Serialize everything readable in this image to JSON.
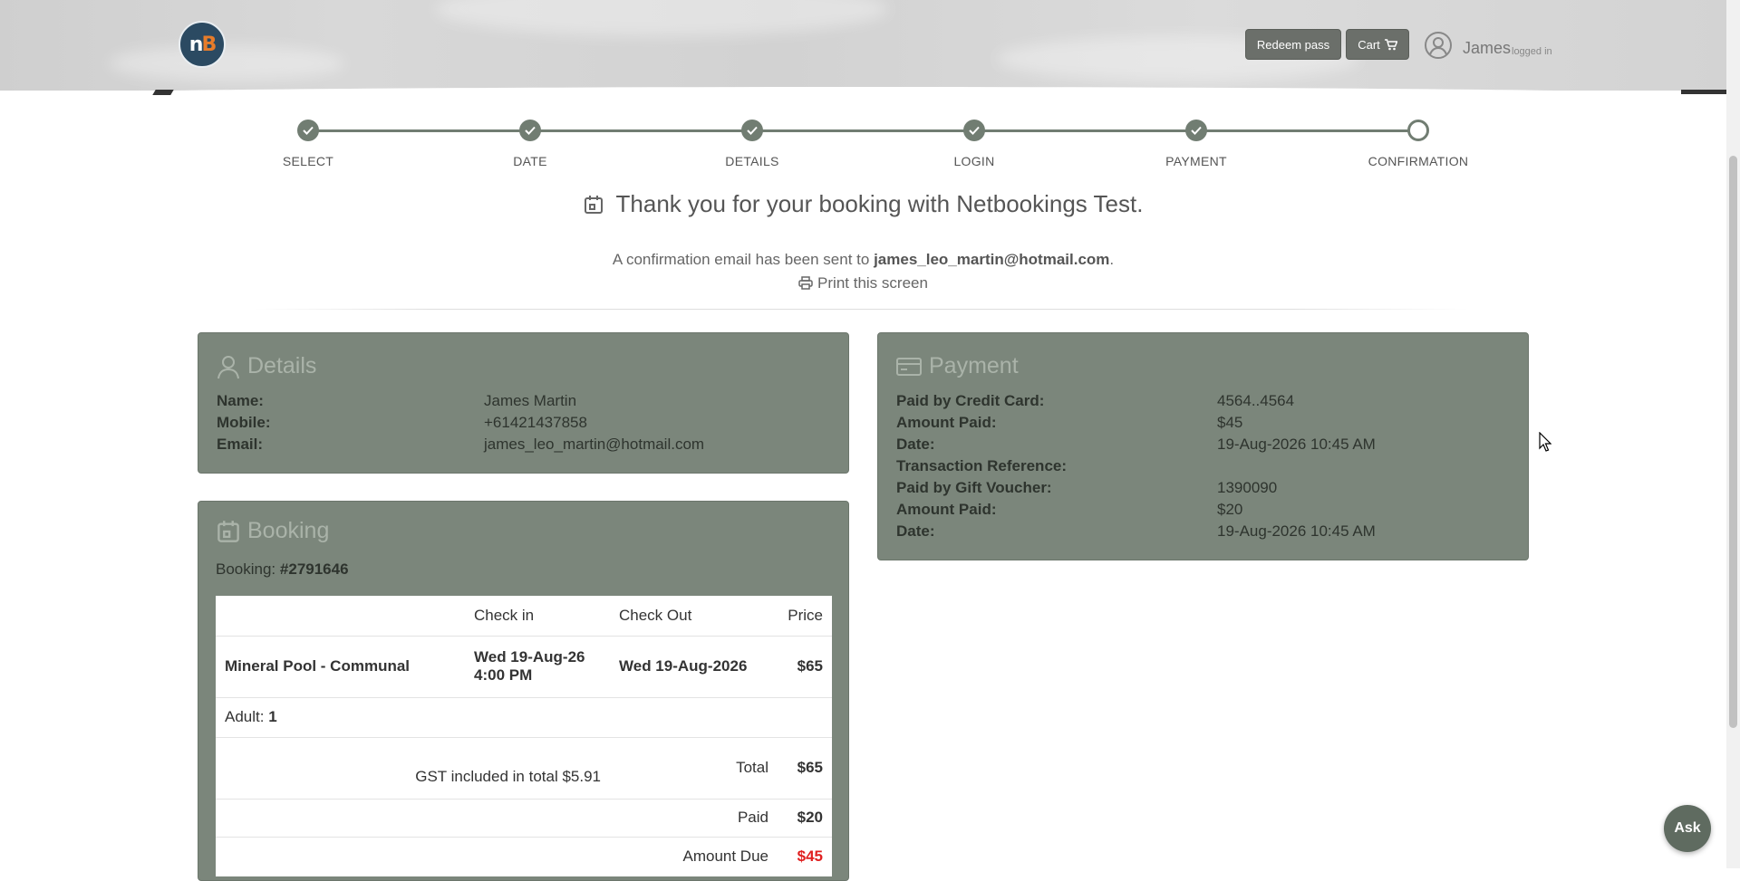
{
  "header": {
    "redeem_label": "Redeem pass",
    "cart_label": "Cart",
    "user_name": "James",
    "user_status": "logged in"
  },
  "steps": [
    {
      "label": "SELECT",
      "complete": true
    },
    {
      "label": "DATE",
      "complete": true
    },
    {
      "label": "DETAILS",
      "complete": true
    },
    {
      "label": "LOGIN",
      "complete": true
    },
    {
      "label": "PAYMENT",
      "complete": true
    },
    {
      "label": "CONFIRMATION",
      "complete": false
    }
  ],
  "confirmation": {
    "thank_you": "Thank you for your booking with Netbookings Test.",
    "email_prefix": "A confirmation email has been sent to",
    "email": "james_leo_martin@hotmail.com",
    "email_suffix": ".",
    "print_label": "Print this screen"
  },
  "details": {
    "title": "Details",
    "rows": [
      {
        "label": "Name:",
        "value": "James Martin"
      },
      {
        "label": "Mobile:",
        "value": "+61421437858"
      },
      {
        "label": "Email:",
        "value": "james_leo_martin@hotmail.com"
      }
    ]
  },
  "payment": {
    "title": "Payment",
    "rows": [
      {
        "label": "Paid by Credit Card:",
        "value": "4564..4564"
      },
      {
        "label": "Amount Paid:",
        "value": "$45"
      },
      {
        "label": "Date:",
        "value": "19-Aug-2026 10:45 AM"
      },
      {
        "label": "Transaction Reference:",
        "value": ""
      },
      {
        "label": "Paid by Gift Voucher:",
        "value": "1390090"
      },
      {
        "label": "Amount Paid:",
        "value": "$20"
      },
      {
        "label": "Date:",
        "value": "19-Aug-2026 10:45 AM"
      }
    ]
  },
  "booking": {
    "title": "Booking",
    "number_label": "Booking:",
    "number": "#2791646",
    "columns": {
      "item": "",
      "checkin": "Check in",
      "checkout": "Check Out",
      "price": "Price"
    },
    "item": {
      "name": "Mineral Pool - Communal",
      "checkin_date": "Wed 19-Aug-26",
      "checkin_time": "4:00 PM",
      "checkout": "Wed 19-Aug-2026",
      "price": "$65"
    },
    "guests_label": "Adult:",
    "guests_count": "1",
    "gst_note": "GST included in total $5.91",
    "total_label": "Total",
    "total": "$65",
    "paid_label": "Paid",
    "paid": "$20",
    "due_label": "Amount Due",
    "due": "$45"
  },
  "ask_label": "Ask",
  "colors": {
    "accent": "#717d72",
    "panel": "#7b867b",
    "due": "#e02020",
    "logo_bg": "#2b4a62",
    "logo_b": "#e77c2a"
  }
}
